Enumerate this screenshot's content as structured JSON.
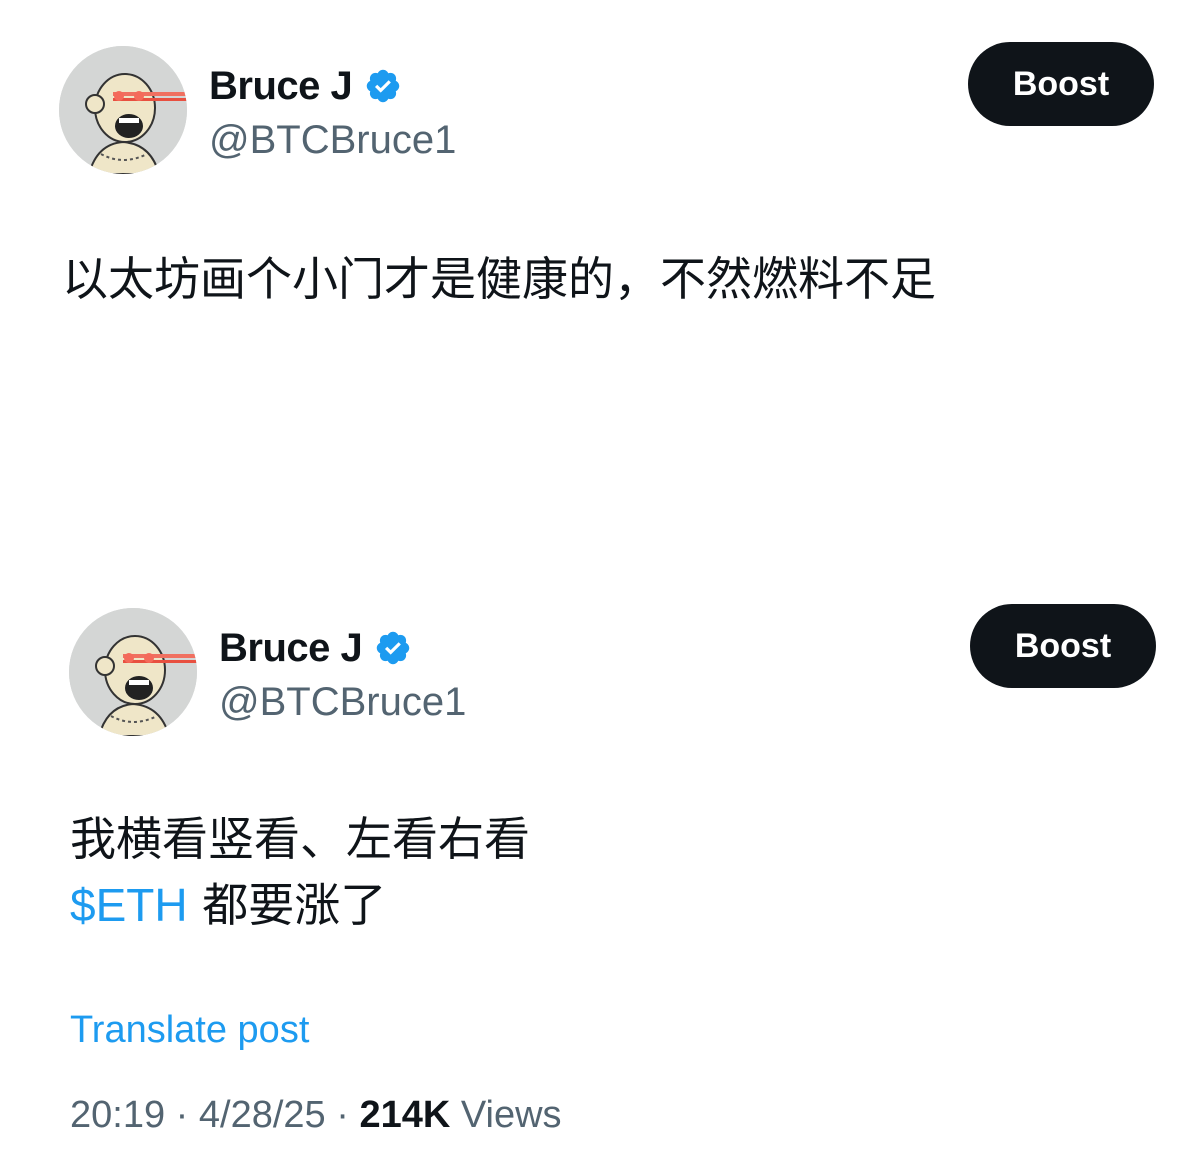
{
  "posts": [
    {
      "author": {
        "display_name": "Bruce J",
        "handle": "@BTCBruce1",
        "verified": true
      },
      "boost_label": "Boost",
      "text_line1": "以太坊画个小门才是健康的，不然燃料不足"
    },
    {
      "author": {
        "display_name": "Bruce J",
        "handle": "@BTCBruce1",
        "verified": true
      },
      "boost_label": "Boost",
      "text_line1": "我横看竖看、左看右看",
      "cashtag": "$ETH",
      "text_line2_rest": "都要涨了",
      "translate_label": "Translate post",
      "time": "20:19",
      "date": "4/28/25",
      "separator": "·",
      "views_count": "214K",
      "views_label": "Views"
    }
  ],
  "colors": {
    "text_primary": "#0f1419",
    "text_secondary": "#536471",
    "link_blue": "#1d9bf0",
    "button_bg": "#0f1419",
    "verified_blue": "#1d9bf0"
  },
  "icons": {
    "verified": "verified-badge-icon",
    "avatar": "ape-avatar-image"
  }
}
